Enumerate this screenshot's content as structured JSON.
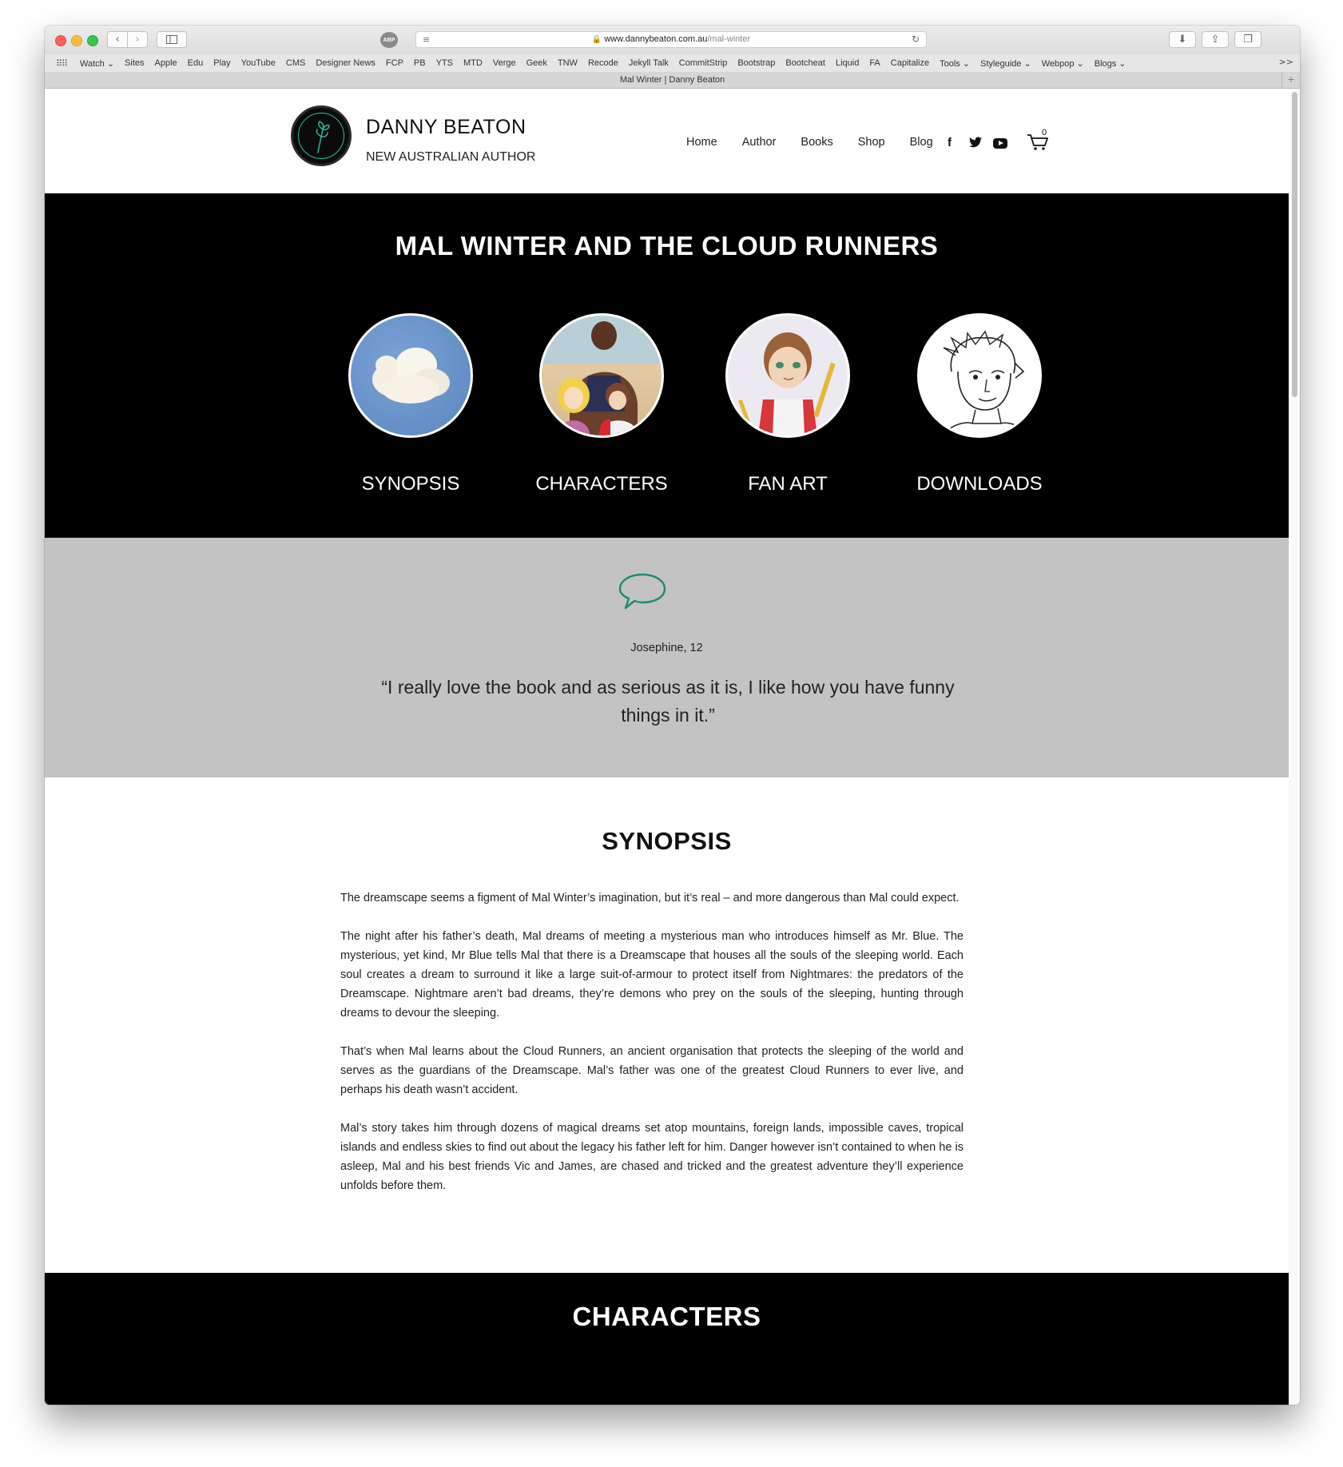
{
  "browser": {
    "url_host": "www.dannybeaton.com.au",
    "url_path": "/mal-winter",
    "tab_title": "Mal Winter | Danny Beaton",
    "adblock_label": "ABP",
    "bookmarks": [
      "Watch ⌄",
      "Sites",
      "Apple",
      "Edu",
      "Play",
      "YouTube",
      "CMS",
      "Designer News",
      "FCP",
      "PB",
      "YTS",
      "MTD",
      "Verge",
      "Geek",
      "TNW",
      "Recode",
      "Jekyll Talk",
      "CommitStrip",
      "Bootstrap",
      "Bootcheat",
      "Liquid",
      "FA",
      "Capitalize",
      "Tools ⌄",
      "Styleguide ⌄",
      "Webpop ⌄",
      "Blogs ⌄"
    ],
    "bookmarks_more": ">>"
  },
  "site": {
    "name": "DANNY BEATON",
    "tagline": "NEW AUSTRALIAN AUTHOR",
    "nav": [
      "Home",
      "Author",
      "Books",
      "Shop",
      "Blog"
    ],
    "cart_count": "0"
  },
  "hero": {
    "title": "MAL WINTER AND THE CLOUD RUNNERS",
    "categories": [
      {
        "label": "SYNOPSIS"
      },
      {
        "label": "CHARACTERS"
      },
      {
        "label": "FAN ART"
      },
      {
        "label": "DOWNLOADS"
      }
    ]
  },
  "testimonial": {
    "author": "Josephine, 12",
    "quote": "“I really love the book and as serious as it is, I like how you have funny things in it.”"
  },
  "synopsis": {
    "title": "SYNOPSIS",
    "paragraphs": [
      "The dreamscape seems a figment of Mal Winter’s imagination, but it’s real – and more dangerous than Mal could expect.",
      "The night after his father’s death, Mal dreams of meeting a mysterious man who introduces himself as Mr. Blue. The mysterious, yet kind, Mr Blue tells Mal that there is a Dreamscape that houses all the souls of the sleeping world. Each soul creates a dream to surround it like a large suit-of-armour to protect itself from Nightmares: the predators of the Dreamscape. Nightmare aren’t bad dreams, they’re demons who prey on the souls of the sleeping, hunting through dreams to devour the sleeping.",
      "That’s when Mal learns about the Cloud Runners, an ancient organisation that protects the sleeping of the world and serves as the guardians of the Dreamscape. Mal’s father was one of the greatest Cloud Runners to ever live, and perhaps his death wasn’t accident.",
      "Mal’s story takes him through dozens of magical dreams set atop mountains, foreign lands, impossible caves, tropical islands and endless skies to find out about the legacy his father left for him. Danger however isn’t contained to when he is asleep, Mal and his best friends Vic and James, are chased and tricked and the greatest adventure they’ll experience unfolds before them."
    ]
  },
  "characters": {
    "title": "CHARACTERS"
  },
  "colors": {
    "accent": "#1e8c76",
    "hero_bg": "#000000",
    "quote_bg": "#c3c3c3"
  }
}
